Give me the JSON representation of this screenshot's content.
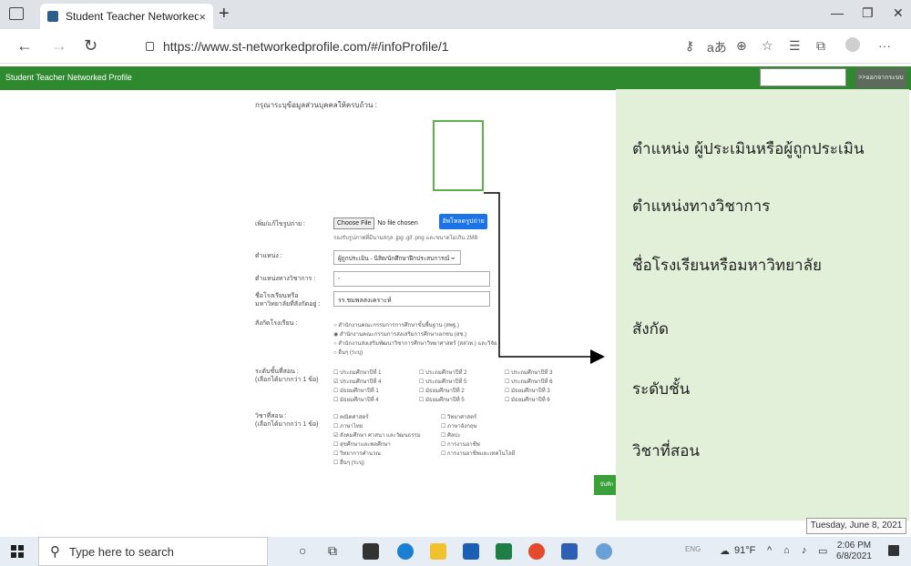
{
  "browser": {
    "tab_title": "Student Teacher Networked Prof",
    "tab_close": "×",
    "new_tab": "+",
    "url": "https://www.st-networkedprofile.com/#/infoProfile/1",
    "reader_label": "aあ",
    "window_controls": {
      "minimize": "—",
      "restore": "❐",
      "close": "✕"
    }
  },
  "site": {
    "brand": "Student Teacher Networked Profile",
    "header_button": ">>ออกจากระบบ"
  },
  "form": {
    "title": "กรุณาระบุข้อมูลส่วนบุคคลให้ครบถ้วน :",
    "photo_label": "เพิ่ม/แก้ไขรูปถ่าย :",
    "choose_file": "Choose File",
    "no_file": "No file chosen",
    "upload_button": "อัพโหลดรูปถ่าย",
    "photo_hint": "รองรับรูปภาพที่มีนามสกุล .jpg .gif .png และขนาดไม่เกิน 2MB",
    "position_label": "ตำแหน่ง :",
    "position_value": "ผู้ถูกประเมิน - นิสิต/นักศึกษาฝึกประสบการณ์",
    "academic_label": "ตำแหน่งทางวิชาการ :",
    "academic_value": "-",
    "school_label": "ชื่อโรงเรียนหรือมหาวิทยาลัยที่สังกัดอยู่ :",
    "school_value": "รร.ชมพลสงเคราะห์",
    "affiliation_label": "สังกัดโรงเรียน :",
    "affiliation_options": [
      "สำนักงานคณะกรรมการการศึกษาขั้นพื้นฐาน (สพฐ.)",
      "สำนักงานคณะกรรมการส่งเสริมการศึกษาเอกชน (สช.)",
      "สำนักงานส่งเสริมพัฒนาวิชาการศึกษาวิทยาศาสตร์ (สสวท.) และวิจัย",
      "อื่นๆ (ระบุ)"
    ],
    "level_label": "ระดับชั้นที่สอน :",
    "level_note": "(เลือกได้มากกว่า 1 ข้อ)",
    "level_options": [
      "ประถมศึกษาปีที่ 1",
      "ประถมศึกษาปีที่ 2",
      "ประถมศึกษาปีที่ 3",
      "ประถมศึกษาปีที่ 4",
      "ประถมศึกษาปีที่ 5",
      "ประถมศึกษาปีที่ 6",
      "มัธยมศึกษาปีที่ 1",
      "มัธยมศึกษาปีที่ 2",
      "มัธยมศึกษาปีที่ 3",
      "มัธยมศึกษาปีที่ 4",
      "มัธยมศึกษาปีที่ 5",
      "มัธยมศึกษาปีที่ 6"
    ],
    "subject_label": "วิชาที่สอน :",
    "subject_note": "(เลือกได้มากกว่า 1 ข้อ)",
    "subject_options": [
      "คณิตศาสตร์",
      "วิทยาศาสตร์",
      "ภาษาไทย",
      "ภาษาอังกฤษ",
      "สังคมศึกษา ศาสนา และวัฒนธรรม",
      "ศิลปะ",
      "สุขศึกษาและพลศึกษา",
      "การงานอาชีพ",
      "วิทยาการคำนวณ",
      "การงานอาชีพและเทคโนโลยี",
      "อื่นๆ (ระบุ)"
    ],
    "save_button": "บันทึกข้อมูล"
  },
  "callout": {
    "items": [
      "ตำแหน่ง ผู้ประเมินหรือผู้ถูกประเมิน",
      "ตำแหน่งทางวิชาการ",
      "ชื่อโรงเรียนหรือมหาวิทยาลัย",
      "สังกัด",
      "ระดับชั้น",
      "วิชาที่สอน"
    ]
  },
  "taskbar": {
    "search_placeholder": "Type here to search",
    "date_tooltip": "Tuesday, June 8, 2021",
    "time": "2:06 PM",
    "date": "6/8/2021",
    "temperature": "91°F",
    "lang": "ENG"
  }
}
